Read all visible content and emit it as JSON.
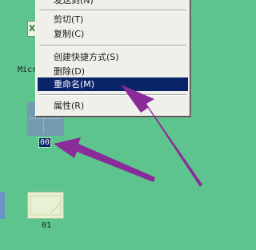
{
  "desktop": {
    "icons": {
      "excel_label": "Micr",
      "folder_label": "00",
      "file_label": "01"
    }
  },
  "context_menu": {
    "items": [
      {
        "label": "发送到(N)",
        "selected": false
      },
      {
        "label": "剪切(T)",
        "selected": false
      },
      {
        "label": "复制(C)",
        "selected": false
      },
      {
        "label": "创建快捷方式(S)",
        "selected": false
      },
      {
        "label": "删除(D)",
        "selected": false
      },
      {
        "label": "重命名(M)",
        "selected": true
      },
      {
        "label": "属性(R)",
        "selected": false
      }
    ]
  },
  "colors": {
    "desktop_background": "#5ec48d",
    "menu_background": "#f0f0ea",
    "selection": "#0a246a",
    "arrow": "#8a2b9a"
  }
}
